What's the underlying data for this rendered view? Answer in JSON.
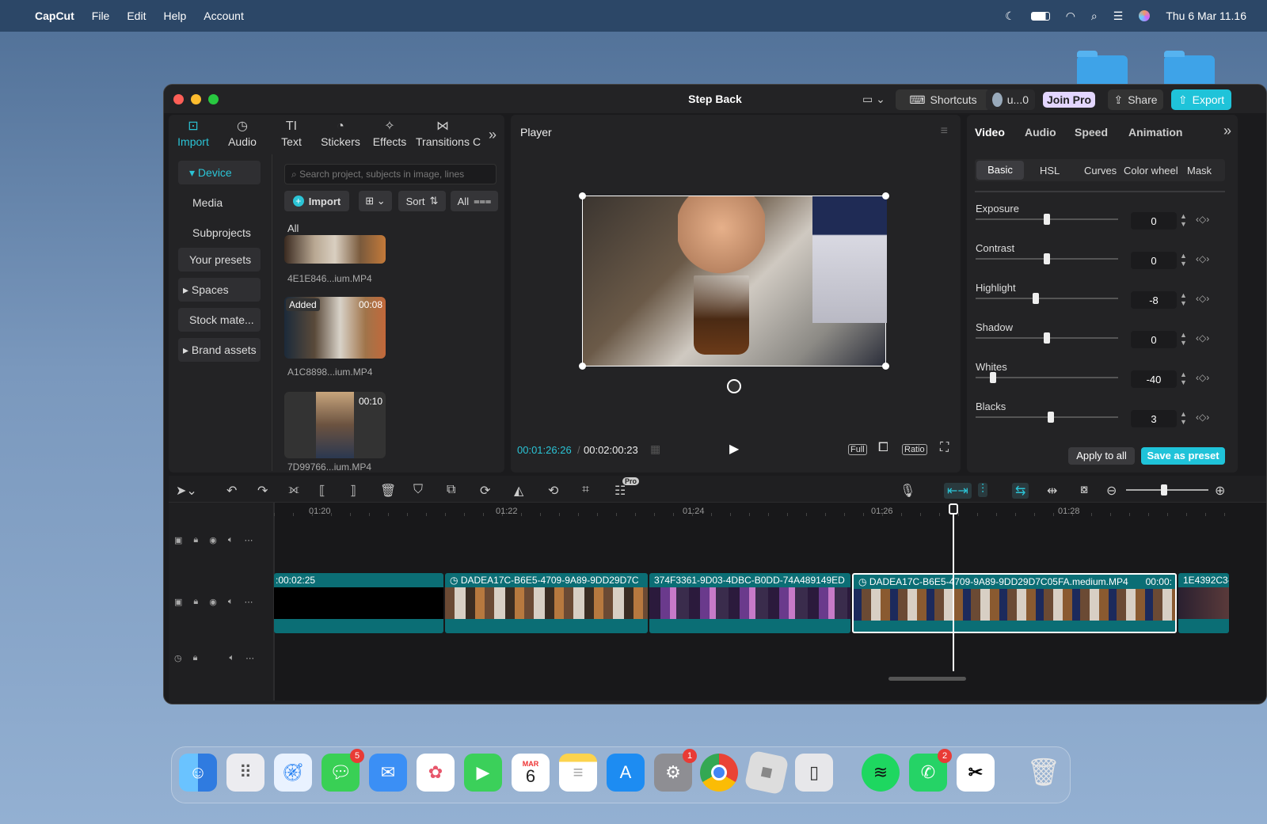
{
  "menubar": {
    "app_name": "CapCut",
    "items": [
      "File",
      "Edit",
      "Help",
      "Account"
    ],
    "clock": "Thu 6 Mar  11.16"
  },
  "window": {
    "title": "Step Back",
    "shortcuts_label": "Shortcuts",
    "user_label": "u...0",
    "join_pro_label": "Join Pro",
    "share_label": "Share",
    "export_label": "Export"
  },
  "media_tabs": [
    {
      "label": "Import",
      "icon": "import-icon"
    },
    {
      "label": "Audio",
      "icon": "audio-icon"
    },
    {
      "label": "Text",
      "icon": "text-icon"
    },
    {
      "label": "Stickers",
      "icon": "stickers-icon"
    },
    {
      "label": "Effects",
      "icon": "effects-icon"
    },
    {
      "label": "Transitions",
      "icon": "transitions-icon"
    },
    {
      "label": "C",
      "icon": "more-tab-icon"
    }
  ],
  "left_nav": {
    "device": "Device",
    "media": "Media",
    "subprojects": "Subprojects",
    "your_presets": "Your presets",
    "spaces": "Spaces",
    "stock": "Stock mate...",
    "brand": "Brand assets"
  },
  "media_panel": {
    "search_placeholder": "Search project, subjects in image, lines",
    "import_label": "Import",
    "sort_label": "Sort",
    "all_filter": "All",
    "section_label": "All",
    "items": [
      {
        "name": "4E1E846...ium.MP4"
      },
      {
        "name": "A1C8898...ium.MP4",
        "badge": "Added",
        "duration": "00:08"
      },
      {
        "name": "7D99766...ium.MP4",
        "duration": "00:10"
      }
    ]
  },
  "player": {
    "title": "Player",
    "current_time": "00:01:26:26",
    "total_time": "00:02:00:23",
    "full_label": "Full",
    "ratio_label": "Ratio"
  },
  "properties": {
    "tabs": [
      "Video",
      "Audio",
      "Speed",
      "Animation"
    ],
    "subtabs": [
      "Basic",
      "HSL",
      "Curves",
      "Color wheel",
      "Mask"
    ],
    "adjustments": [
      {
        "label": "Exposure",
        "value": "0",
        "pos": 0.5
      },
      {
        "label": "Contrast",
        "value": "0",
        "pos": 0.5
      },
      {
        "label": "Highlight",
        "value": "-8",
        "pos": 0.42
      },
      {
        "label": "Shadow",
        "value": "0",
        "pos": 0.5
      },
      {
        "label": "Whites",
        "value": "-40",
        "pos": 0.12
      },
      {
        "label": "Blacks",
        "value": "3",
        "pos": 0.53
      }
    ],
    "apply_all": "Apply to all",
    "save_preset": "Save as preset"
  },
  "timeline": {
    "pro_badge": "Pro",
    "ruler": [
      "01:20",
      "01:22",
      "01:24",
      "01:26",
      "01:28"
    ],
    "clips": [
      {
        "label": ":00:02:25"
      },
      {
        "label": "DADEA17C-B6E5-4709-9A89-9DD29D7C"
      },
      {
        "label": "374F3361-9D03-4DBC-B0DD-74A489149ED"
      },
      {
        "label": "DADEA17C-B6E5-4709-9A89-9DD29D7C05FA.medium.MP4",
        "time": "00:00:"
      },
      {
        "label": "1E4392C3-"
      }
    ]
  },
  "dock": {
    "calendar_month": "MAR",
    "calendar_day": "6",
    "badges": {
      "messages": "5",
      "settings": "1",
      "whatsapp": "2"
    }
  }
}
